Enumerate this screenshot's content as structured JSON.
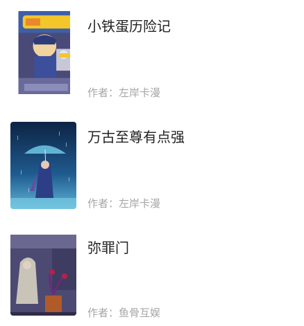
{
  "comics": [
    {
      "title": "小铁蛋历险记",
      "author_prefix": "作者：",
      "author": "左岸卡漫"
    },
    {
      "title": "万古至尊有点强",
      "author_prefix": "作者：",
      "author": "左岸卡漫"
    },
    {
      "title": "弥罪门",
      "author_prefix": "作者：",
      "author": "鱼骨互娱"
    }
  ]
}
